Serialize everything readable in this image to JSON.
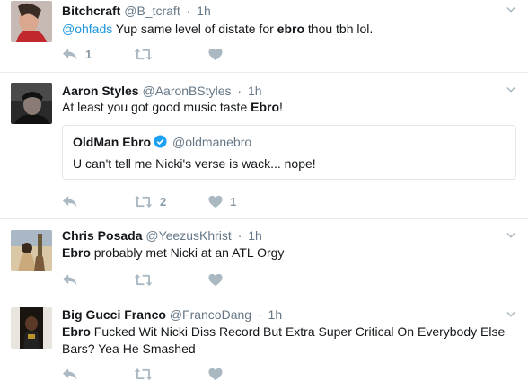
{
  "tweets": [
    {
      "name": "Bitchcraft",
      "handle": "@B_tcraft",
      "time": "1h",
      "text_mention": "@ohfads",
      "text_pre": " Yup same level of distate for ",
      "text_kw": "ebro",
      "text_post": " thou tbh lol.",
      "reply_count": "1",
      "retweet_count": "",
      "like_count": ""
    },
    {
      "name": "Aaron Styles",
      "handle": "@AaronBStyles",
      "time": "1h",
      "text_pre": "At least you got good music taste ",
      "text_kw": "Ebro",
      "text_post": "!",
      "quote": {
        "name": "OldMan Ebro",
        "handle": "@oldmanebro",
        "text": "U can't tell me Nicki's verse is wack... nope!"
      },
      "reply_count": "",
      "retweet_count": "2",
      "like_count": "1"
    },
    {
      "name": "Chris Posada",
      "handle": "@YeezusKhrist",
      "time": "1h",
      "text_kw": "Ebro",
      "text_post": " probably met Nicki at an ATL Orgy",
      "reply_count": "",
      "retweet_count": "",
      "like_count": ""
    },
    {
      "name": "Big Gucci Franco",
      "handle": "@FrancoDang",
      "time": "1h",
      "text_kw": "Ebro",
      "text_post": " Fucked Wit Nicki Diss Record But Extra Super Critical On Everybody Else Bars? Yea He Smashed",
      "reply_count": "",
      "retweet_count": "",
      "like_count": ""
    }
  ],
  "dot": "·",
  "icons": {
    "reply": "reply-icon",
    "retweet": "retweet-icon",
    "like": "heart-icon",
    "more": "chevron-down-icon",
    "verified": "verified-badge-icon"
  },
  "colors": {
    "mention": "#1b95e0",
    "verified": "#1da1f2",
    "action": "#aab8c2"
  }
}
